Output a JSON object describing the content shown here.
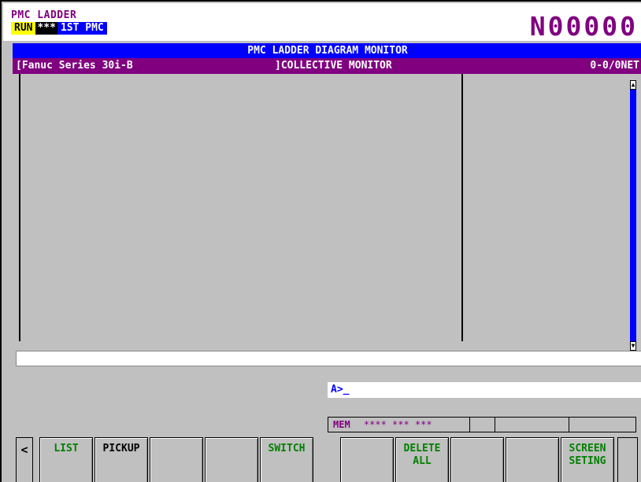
{
  "header": {
    "mode_title": "PMC LADDER",
    "run_status": "RUN",
    "alarm_status": "***",
    "pmc_select": "1ST PMC",
    "program_number": "N00000"
  },
  "title_bar": {
    "title": "PMC LADDER DIAGRAM MONITOR"
  },
  "sub_bar": {
    "left": "[Fanuc Series 30i-B",
    "middle": "]COLLECTIVE MONITOR",
    "right": "0-0/0NET"
  },
  "key_input": {
    "prompt": "A>_"
  },
  "status_bar": {
    "mode": "MEM",
    "status_fields": "**** *** ***"
  },
  "softkeys": {
    "left_arrow": "<",
    "list": "LIST",
    "pickup": "PICKUP",
    "switch": "SWITCH",
    "delete_all_1": "DELETE",
    "delete_all_2": "ALL",
    "screen_setting_1": "SCREEN",
    "screen_setting_2": "SETING"
  },
  "colors": {
    "title_bar": "#0000ff",
    "sub_bar": "#800080",
    "softkey_text": "#008000",
    "run_bg": "#ffff00"
  }
}
